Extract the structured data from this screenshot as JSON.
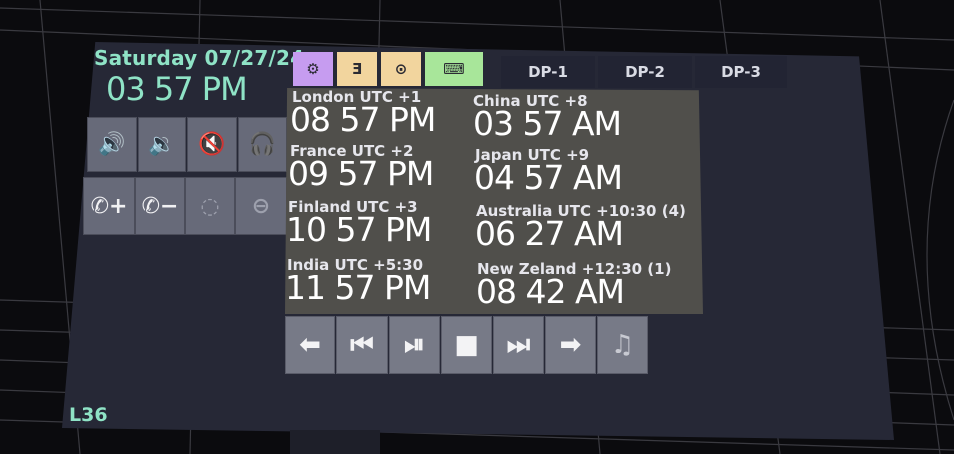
{
  "header": {
    "date": "Saturday 07/27/24",
    "time": "03 57 PM"
  },
  "tabs": [
    {
      "label": "⚙",
      "icon": "gear-icon",
      "color": "#c69cf0"
    },
    {
      "label": "Ǝ",
      "icon": "reverse-e-icon",
      "color": "#f2d59e"
    },
    {
      "label": "⊙",
      "icon": "circle-dot-icon",
      "color": "#f2d59e"
    },
    {
      "label": "⌨",
      "icon": "keyboard-icon",
      "color": "#a8e69a"
    }
  ],
  "dp_tabs": [
    "DP-1",
    "DP-2",
    "DP-3"
  ],
  "audio_buttons": [
    {
      "label": "🔊",
      "icon": "volume-up-icon"
    },
    {
      "label": "🔉",
      "icon": "volume-down-icon"
    },
    {
      "label": "🔇",
      "icon": "mute-icon"
    },
    {
      "label": "🎧",
      "icon": "headphones-icon"
    }
  ],
  "call_buttons": [
    {
      "label": "✆+",
      "icon": "phone-plus-icon"
    },
    {
      "label": "✆−",
      "icon": "phone-minus-icon"
    },
    {
      "label": "◌",
      "icon": "dial-icon"
    },
    {
      "label": "⊖",
      "icon": "minus-circle-icon"
    }
  ],
  "clocks": [
    {
      "city": "London UTC +1",
      "time": "08 57 PM"
    },
    {
      "city": "China UTC +8",
      "time": "03 57 AM"
    },
    {
      "city": "France UTC +2",
      "time": "09 57 PM"
    },
    {
      "city": "Japan UTC +9",
      "time": "04 57 AM"
    },
    {
      "city": "Finland UTC +3",
      "time": "10 57 PM"
    },
    {
      "city": "Australia UTC +10:30 (4)",
      "time": "06 27 AM"
    },
    {
      "city": "India UTC +5:30",
      "time": "11 57 PM"
    },
    {
      "city": "New Zeland +12:30 (1)",
      "time": "08 42 AM"
    }
  ],
  "media_buttons": [
    {
      "label": "⬅",
      "icon": "arrow-left-icon"
    },
    {
      "label": "⏮",
      "icon": "previous-track-icon"
    },
    {
      "label": "⏯",
      "icon": "play-pause-icon"
    },
    {
      "label": "■",
      "icon": "stop-icon"
    },
    {
      "label": "⏭",
      "icon": "next-track-icon"
    },
    {
      "label": "➡",
      "icon": "arrow-right-icon"
    },
    {
      "label": "♫",
      "icon": "music-note-icon"
    }
  ],
  "footer": {
    "level": "L36"
  }
}
